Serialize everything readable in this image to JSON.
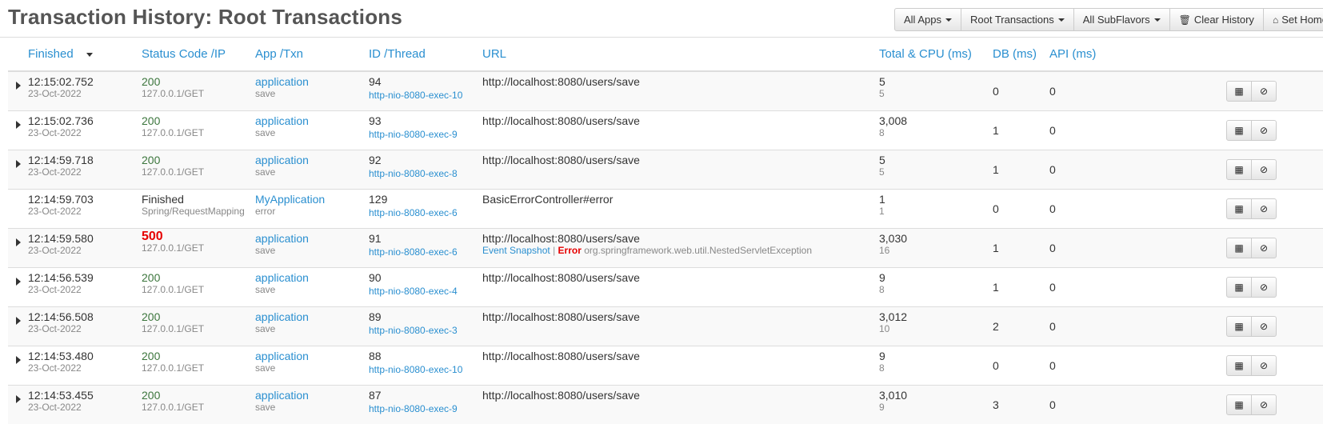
{
  "page": {
    "title": "Transaction History: Root Transactions"
  },
  "toolbar": {
    "all_apps": "All Apps",
    "root_transactions": "Root Transactions",
    "all_subflavors": "All SubFlavors",
    "clear_history": "Clear History",
    "set_home": "Set Home"
  },
  "columns": {
    "finished": "Finished",
    "status": "Status Code /IP",
    "app": "App /Txn",
    "id": "ID /Thread",
    "url": "URL",
    "total": "Total & CPU (ms)",
    "db": "DB (ms)",
    "api": "API (ms)"
  },
  "rows": [
    {
      "time": "12:15:02.752",
      "date": "23-Oct-2022",
      "status": "200",
      "ip": "127.0.0.1/GET",
      "app": "application",
      "txn": "save",
      "id": "94",
      "thread": "http-nio-8080-exec-10",
      "url": "http://localhost:8080/users/save",
      "total": "5",
      "cpu": "5",
      "db": "0",
      "api": "0"
    },
    {
      "time": "12:15:02.736",
      "date": "23-Oct-2022",
      "status": "200",
      "ip": "127.0.0.1/GET",
      "app": "application",
      "txn": "save",
      "id": "93",
      "thread": "http-nio-8080-exec-9",
      "url": "http://localhost:8080/users/save",
      "total": "3,008",
      "cpu": "8",
      "db": "1",
      "api": "0"
    },
    {
      "time": "12:14:59.718",
      "date": "23-Oct-2022",
      "status": "200",
      "ip": "127.0.0.1/GET",
      "app": "application",
      "txn": "save",
      "id": "92",
      "thread": "http-nio-8080-exec-8",
      "url": "http://localhost:8080/users/save",
      "total": "5",
      "cpu": "5",
      "db": "1",
      "api": "0"
    },
    {
      "time": "12:14:59.703",
      "date": "23-Oct-2022",
      "status": "Finished",
      "ip": "Spring/RequestMapping",
      "app": "MyApplication",
      "txn": "error",
      "id": "129",
      "thread": "http-nio-8080-exec-6",
      "url": "BasicErrorController#error",
      "total": "1",
      "cpu": "1",
      "db": "0",
      "api": "0"
    },
    {
      "time": "12:14:59.580",
      "date": "23-Oct-2022",
      "status": "500",
      "ip": "127.0.0.1/GET",
      "app": "application",
      "txn": "save",
      "id": "91",
      "thread": "http-nio-8080-exec-6",
      "url": "http://localhost:8080/users/save",
      "event_snapshot": "Event Snapshot",
      "error_label": "Error",
      "error_text": "org.springframework.web.util.NestedServletException",
      "total": "3,030",
      "cpu": "16",
      "db": "1",
      "api": "0"
    },
    {
      "time": "12:14:56.539",
      "date": "23-Oct-2022",
      "status": "200",
      "ip": "127.0.0.1/GET",
      "app": "application",
      "txn": "save",
      "id": "90",
      "thread": "http-nio-8080-exec-4",
      "url": "http://localhost:8080/users/save",
      "total": "9",
      "cpu": "8",
      "db": "1",
      "api": "0"
    },
    {
      "time": "12:14:56.508",
      "date": "23-Oct-2022",
      "status": "200",
      "ip": "127.0.0.1/GET",
      "app": "application",
      "txn": "save",
      "id": "89",
      "thread": "http-nio-8080-exec-3",
      "url": "http://localhost:8080/users/save",
      "total": "3,012",
      "cpu": "10",
      "db": "2",
      "api": "0"
    },
    {
      "time": "12:14:53.480",
      "date": "23-Oct-2022",
      "status": "200",
      "ip": "127.0.0.1/GET",
      "app": "application",
      "txn": "save",
      "id": "88",
      "thread": "http-nio-8080-exec-10",
      "url": "http://localhost:8080/users/save",
      "total": "9",
      "cpu": "8",
      "db": "0",
      "api": "0"
    },
    {
      "time": "12:14:53.455",
      "date": "23-Oct-2022",
      "status": "200",
      "ip": "127.0.0.1/GET",
      "app": "application",
      "txn": "save",
      "id": "87",
      "thread": "http-nio-8080-exec-9",
      "url": "http://localhost:8080/users/save",
      "total": "3,010",
      "cpu": "9",
      "db": "3",
      "api": "0"
    }
  ],
  "icons": {
    "details": "book-icon",
    "cancel": "ban-icon",
    "clear": "trash-icon",
    "home": "home-icon"
  },
  "colors": {
    "link": "#2a8fd0",
    "ok": "#3c763d",
    "error": "#e60000"
  }
}
